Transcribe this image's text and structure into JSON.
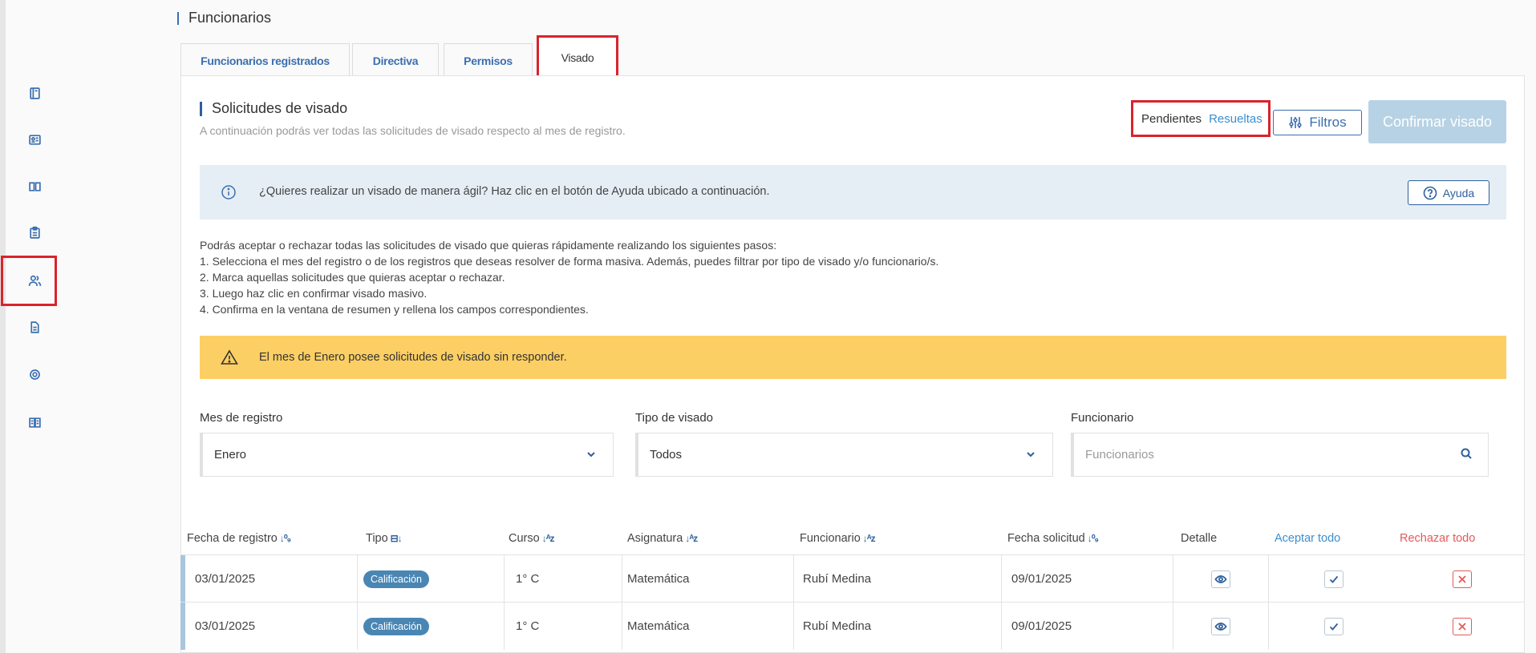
{
  "page": {
    "title": "Funcionarios"
  },
  "tabs": [
    {
      "label": "Funcionarios registrados"
    },
    {
      "label": "Directiva"
    },
    {
      "label": "Permisos"
    },
    {
      "label": "Visado"
    }
  ],
  "sidebar": {
    "items": [
      {
        "icon": "book-icon"
      },
      {
        "icon": "id-card-icon"
      },
      {
        "icon": "open-book-icon"
      },
      {
        "icon": "clipboard-icon"
      },
      {
        "icon": "users-icon",
        "selected": true
      },
      {
        "icon": "document-icon"
      },
      {
        "icon": "gear-icon"
      },
      {
        "icon": "manual-icon"
      }
    ]
  },
  "section": {
    "title": "Solicitudes de visado",
    "subtitle": "A continuación podrás ver todas las solicitudes de visado respecto al mes de registro."
  },
  "toggle": {
    "pending": "Pendientes",
    "resolved": "Resueltas"
  },
  "toolbar": {
    "filters_label": "Filtros",
    "confirm_label": "Confirmar visado"
  },
  "info": {
    "text": "¿Quieres realizar un visado de manera ágil? Haz clic en el botón de Ayuda ubicado a continuación.",
    "help_label": "Ayuda"
  },
  "instructions": [
    "Podrás aceptar o rechazar todas las solicitudes de visado que quieras rápidamente realizando los siguientes pasos:",
    "1. Selecciona el mes del registro o de los registros que deseas resolver de forma masiva. Además, puedes filtrar por tipo de visado y/o funcionario/s.",
    "2. Marca aquellas solicitudes que quieras aceptar o rechazar.",
    "3. Luego haz clic en confirmar visado masivo.",
    "4. Confirma en la ventana de resumen y rellena los campos correspondientes."
  ],
  "warning": {
    "text": "El mes de Enero posee solicitudes de visado sin responder."
  },
  "filters": {
    "month": {
      "label": "Mes de registro",
      "value": "Enero"
    },
    "type": {
      "label": "Tipo de visado",
      "value": "Todos"
    },
    "staff": {
      "label": "Funcionario",
      "placeholder": "Funcionarios"
    }
  },
  "table": {
    "headers": {
      "fecha_registro": "Fecha de registro",
      "tipo": "Tipo",
      "curso": "Curso",
      "asignatura": "Asignatura",
      "funcionario": "Funcionario",
      "fecha_solicitud": "Fecha solicitud",
      "detalle": "Detalle",
      "aceptar": "Aceptar todo",
      "rechazar": "Rechazar todo"
    },
    "rows": [
      {
        "fecha_registro": "03/01/2025",
        "tipo": "Calificación",
        "curso": "1° C",
        "asignatura": "Matemática",
        "funcionario": "Rubí Medina",
        "fecha_solicitud": "09/01/2025"
      },
      {
        "fecha_registro": "03/01/2025",
        "tipo": "Calificación",
        "curso": "1° C",
        "asignatura": "Matemática",
        "funcionario": "Rubí Medina",
        "fecha_solicitud": "09/01/2025"
      }
    ]
  },
  "colors": {
    "accent": "#3a6fb0",
    "highlight": "#d9232d",
    "warning": "#fccf64",
    "info": "#e5eef5",
    "confirm": "#b7d2e4"
  }
}
